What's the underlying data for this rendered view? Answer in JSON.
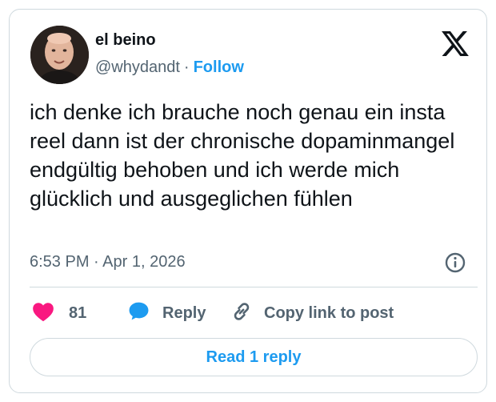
{
  "author": {
    "name": "el beino",
    "handle": "@whydandt",
    "separator": "·",
    "follow_label": "Follow"
  },
  "tweet": {
    "text": "ich denke ich brauche noch genau ein insta reel dann ist der chronische dopaminmangel endgültig behoben und ich werde mich glücklich und ausgeglichen fühlen",
    "timestamp": "6:53 PM · Apr 1, 2026"
  },
  "actions": {
    "like_count": "81",
    "reply_label": "Reply",
    "copy_label": "Copy link to post"
  },
  "footer": {
    "read_replies_label": "Read 1 reply"
  },
  "colors": {
    "accent": "#1d9bf0",
    "like": "#f91880",
    "text": "#0f1419",
    "muted": "#536471",
    "border": "#cfd9de"
  },
  "icons": {
    "logo": "x-logo-icon",
    "info": "info-icon",
    "like": "heart-icon",
    "reply": "speech-bubble-icon",
    "copy": "link-icon"
  }
}
